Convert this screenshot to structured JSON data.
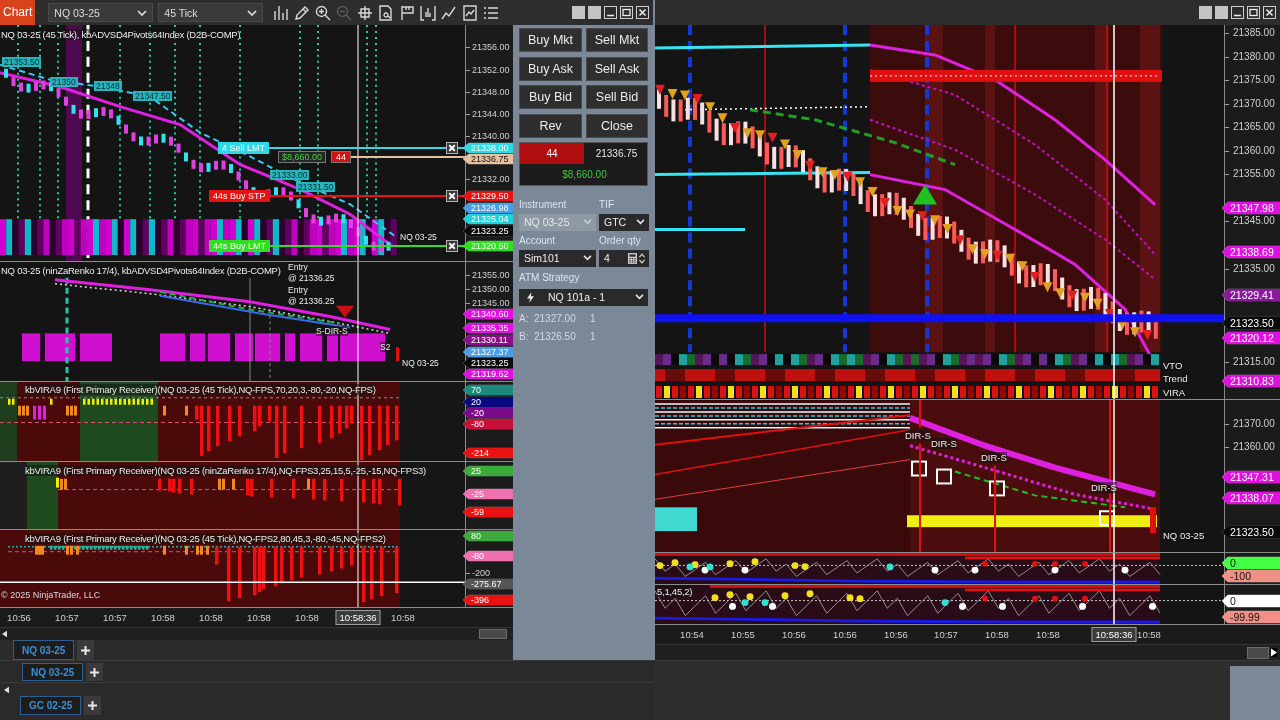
{
  "left_window": {
    "toolbar": {
      "title": "Chart",
      "instrument": "NQ 03-25",
      "interval": "45 Tick",
      "tools": [
        {
          "disabled": false
        },
        {
          "disabled": false
        },
        {
          "disabled": false
        },
        {
          "disabled": true
        },
        {
          "disabled": false
        },
        {
          "disabled": false
        },
        {
          "disabled": false
        },
        {
          "disabled": false
        },
        {
          "disabled": false
        },
        {
          "disabled": false
        },
        {
          "disabled": false
        }
      ]
    },
    "chart": {
      "panels": [
        {
          "title": "NQ 03-25 (45 Tick), kbADVSD4Pivots64Index (D2B-COMP)",
          "axis_ticks": [
            "21356.00",
            "21352.00",
            "21348.00",
            "21344.00",
            "21340.00",
            "21332.00"
          ],
          "price_markers": [
            {
              "label": "21338.00",
              "color": "#30d8e6"
            },
            {
              "label": "21336.75",
              "color": "#e6c0a0"
            },
            {
              "label": "21329.50",
              "color": "#e81212"
            },
            {
              "label": "21326.98",
              "color": "#4a9ee8"
            },
            {
              "label": "21325.04",
              "color": "#22d0dc"
            },
            {
              "label": "21323.25",
              "color": "#0a0a0a"
            },
            {
              "label": "21320.50",
              "color": "#30e020"
            }
          ],
          "price_tags": [
            "21353.50",
            "21350",
            "21348",
            "21347.50",
            "21333.00",
            "21331.50"
          ],
          "plot_labels": [
            "NQ 03-25"
          ],
          "order_lines": [
            {
              "kind": "order",
              "label": "4 Sell LMT",
              "color": "#30d8e6"
            },
            {
              "kind": "position",
              "pnl": "$8,660.00",
              "quantity": "44",
              "color": "#e6c0a0"
            },
            {
              "kind": "order",
              "label": "44s Buy STP",
              "color": "#e81212"
            },
            {
              "kind": "order",
              "label": "44s Buy LMT",
              "color": "#30e020"
            }
          ]
        },
        {
          "title": "NQ 03-25 (ninZaRenko 17/4), kbADVSD4Pivots64Index (D2B-COMP)",
          "axis_ticks": [
            "21355.00",
            "21350.00",
            "21345.00"
          ],
          "price_markers": [
            {
              "label": "21340.60",
              "color": "#e010e0"
            },
            {
              "label": "21335.35",
              "color": "#e010e0"
            },
            {
              "label": "21330.11",
              "color": "#8a108a"
            },
            {
              "label": "21327.37",
              "color": "#4a9ee8"
            },
            {
              "label": "21323.25",
              "color": "#0a0a0a"
            },
            {
              "label": "21319.62",
              "color": "#e010e0"
            }
          ],
          "plot_labels": [
            "Entry",
            "@ 21336.25",
            "Entry",
            "@ 21336.25",
            "S-DIR-S",
            "S2",
            "NQ 03-25"
          ]
        },
        {
          "title": "kbVIRA9 (First Primary Receiver)(NQ 03-25 (45 Tick),NQ-FPS,70,20,3,-80,-20,NQ-FPS)",
          "price_markers": [
            {
              "label": "70",
              "color": "#1a8a7a"
            },
            {
              "label": "20",
              "color": "#0a0a80"
            },
            {
              "label": "-20",
              "color": "#7a0a8a"
            },
            {
              "label": "-80",
              "color": "#c8103a"
            },
            {
              "label": "-214",
              "color": "#e81212"
            }
          ]
        },
        {
          "title": "kbVIRA9 (First Primary Receiver)(NQ 03-25 (ninZaRenko 17/4),NQ-FPS3,25,15,5,-25,-15,NQ-FPS3)",
          "price_markers": [
            {
              "label": "25",
              "color": "#3aaa3a"
            },
            {
              "label": "-25",
              "color": "#f070b0"
            },
            {
              "label": "-59",
              "color": "#e81212"
            }
          ]
        },
        {
          "title": "kbVIRA9 (First Primary Receiver)(NQ 03-25 (45 Tick),NQ-FPS2,80,45,3,-80,-45,NQ-FPS2)",
          "axis_ticks": [
            "-200"
          ],
          "price_markers": [
            {
              "label": "80",
              "color": "#3aaa3a"
            },
            {
              "label": "-80",
              "color": "#f070b0"
            },
            {
              "label": "-275.67",
              "color": "#555555"
            },
            {
              "label": "-396",
              "color": "#e81212"
            }
          ],
          "copyright": "© 2025 NinjaTrader, LLC"
        }
      ],
      "time_axis": [
        {
          "label": "10:56",
          "kind": "tick"
        },
        {
          "label": "10:57",
          "kind": "tick"
        },
        {
          "label": "10:57",
          "kind": "tick"
        },
        {
          "label": "10:58",
          "kind": "tick"
        },
        {
          "label": "10:58",
          "kind": "tick"
        },
        {
          "label": "10:58",
          "kind": "tick"
        },
        {
          "label": "10:58",
          "kind": "tick"
        },
        {
          "label": "10:58:36",
          "kind": "cursor"
        },
        {
          "label": "10:58",
          "kind": "tick"
        }
      ]
    },
    "chart_tabs": [
      {
        "label": "NQ 03-25",
        "selected": true
      }
    ]
  },
  "order_panel": {
    "buttons": [
      "Buy Mkt",
      "Sell Mkt",
      "Buy Ask",
      "Sell Ask",
      "Buy Bid",
      "Sell Bid",
      "Rev",
      "Close"
    ],
    "position": {
      "quantity": "44",
      "price": "21336.75",
      "pnl": "$8,660.00"
    },
    "fields": [
      {
        "label": "Instrument",
        "value": "NQ 03-25",
        "kind": "dropdown",
        "disabled": true
      },
      {
        "label": "TIF",
        "value": "GTC",
        "kind": "dropdown",
        "disabled": false
      },
      {
        "label": "Account",
        "value": "Sim101",
        "kind": "dropdown",
        "disabled": false
      },
      {
        "label": "Order qty",
        "value": "4",
        "kind": "spinner",
        "disabled": false
      }
    ],
    "atm_strategy": {
      "label": "ATM Strategy",
      "value": "NQ 101a - 1"
    },
    "brackets": [
      {
        "name": "A:",
        "price": "21327.00",
        "quantity": "1"
      },
      {
        "name": "B:",
        "price": "21326.50",
        "quantity": "1"
      }
    ]
  },
  "right_window": {
    "chart": {
      "panels": [
        {
          "axis_ticks": [
            "21385.00",
            "21380.00",
            "21375.00",
            "21370.00",
            "21365.00",
            "21360.00",
            "21355.00",
            "21345.00",
            "21335.00",
            "21315.00"
          ],
          "price_markers": [
            {
              "label": "21347.98",
              "color": "#e010e0"
            },
            {
              "label": "21338.69",
              "color": "#e010e0"
            },
            {
              "label": "21329.41",
              "color": "#8a1a9a"
            },
            {
              "label": "21323.50",
              "color": "#0a0a0a"
            },
            {
              "label": "21320.12",
              "color": "#e010e0"
            },
            {
              "label": "21310.83",
              "color": "#e010e0"
            }
          ],
          "plot_labels": [
            "VTO",
            "Trend",
            "VIRA"
          ]
        },
        {
          "axis_ticks": [
            "21370.00",
            "21360.00"
          ],
          "price_markers": [
            {
              "label": "21347.31",
              "color": "#e010e0"
            },
            {
              "label": "21338.07",
              "color": "#e010e0"
            },
            {
              "label": "21323.50",
              "color": "#0a0a0a"
            }
          ],
          "plot_labels": [
            "DIR-S",
            "DIR-S",
            "DIR-S",
            "DIR-S",
            "NQ 03-25"
          ]
        },
        {
          "price_markers": [
            {
              "label": "0",
              "color": "#44ff44"
            },
            {
              "label": "-100",
              "color": "#f09088"
            }
          ]
        },
        {
          "title": "5,1,45,2)",
          "price_markers": [
            {
              "label": "0",
              "color": "#ffffff"
            },
            {
              "label": "-99.99",
              "color": "#f09088"
            }
          ]
        }
      ],
      "time_axis": [
        {
          "label": "10:54",
          "kind": "tick"
        },
        {
          "label": "10:55",
          "kind": "tick"
        },
        {
          "label": "10:56",
          "kind": "tick"
        },
        {
          "label": "10:56",
          "kind": "tick"
        },
        {
          "label": "10:56",
          "kind": "tick"
        },
        {
          "label": "10:57",
          "kind": "tick"
        },
        {
          "label": "10:58",
          "kind": "tick"
        },
        {
          "label": "10:58",
          "kind": "tick"
        },
        {
          "label": "10:58:36",
          "kind": "cursor"
        },
        {
          "label": "10:58",
          "kind": "tick"
        }
      ]
    }
  },
  "background_windows": [
    {
      "tabs": [
        {
          "label": "NQ 03-25",
          "selected": true
        }
      ]
    },
    {
      "tabs": [
        {
          "label": "GC 02-25",
          "selected": true
        }
      ]
    }
  ]
}
